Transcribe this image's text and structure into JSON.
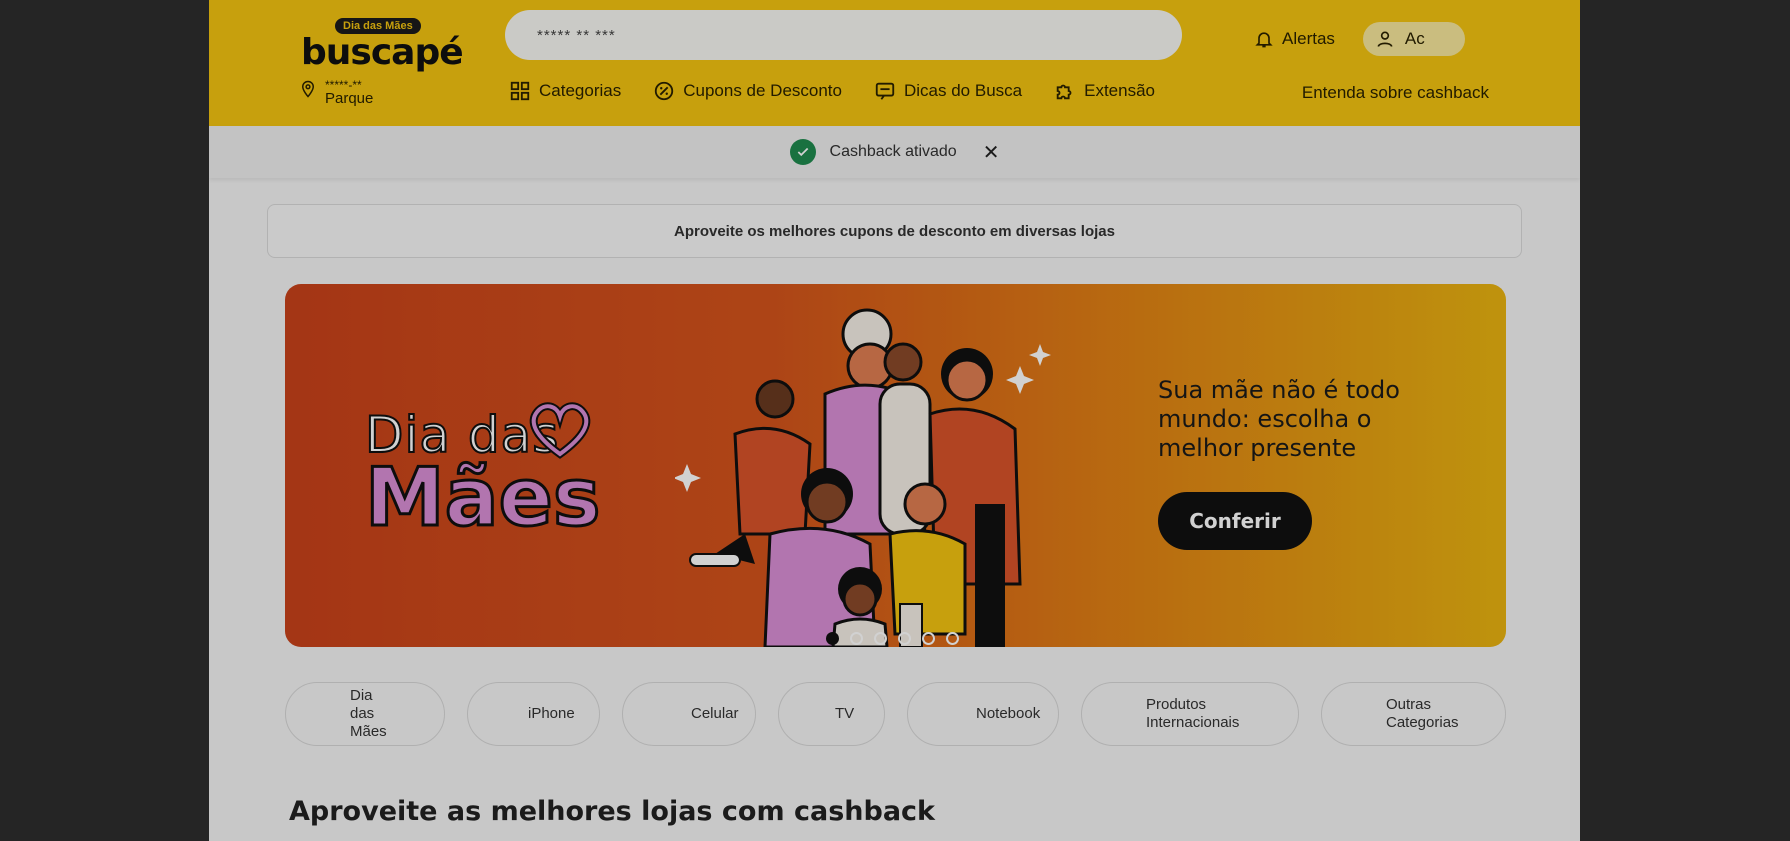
{
  "header": {
    "logo_badge": "Dia das Mães",
    "logo_text": "buscapé",
    "location_line1": "*****-**",
    "location_line2": "Parque",
    "search_value": "***** ** ***",
    "alerts_label": "Alertas",
    "account_label": "Ac",
    "nav": [
      {
        "label": "Categorias",
        "icon": "grid-icon"
      },
      {
        "label": "Cupons de Desconto",
        "icon": "coupon-icon"
      },
      {
        "label": "Dicas do Busca",
        "icon": "chat-icon"
      },
      {
        "label": "Extensão",
        "icon": "puzzle-icon"
      }
    ],
    "cashback_link": "Entenda sobre cashback"
  },
  "cashback_bar": {
    "text": "Cashback ativado",
    "close": "✕"
  },
  "promo_strip": "Aproveite os melhores cupons de desconto em diversas lojas",
  "banner": {
    "title_line1": "Dia das",
    "title_line2": "Mães",
    "copy": "Sua mãe não é todo mundo: escolha o melhor presente",
    "cta": "Conferir",
    "slides": 6,
    "active_slide": 1
  },
  "chips": [
    {
      "label": "Dia das Mães"
    },
    {
      "label": "iPhone"
    },
    {
      "label": "Celular"
    },
    {
      "label": "TV"
    },
    {
      "label": "Notebook"
    },
    {
      "label": "Produtos Internacionais"
    },
    {
      "label": "Outras Categorias"
    }
  ],
  "section_title": "Aproveite as melhores lojas com cashback",
  "colors": {
    "brand_yellow": "#f3c410",
    "banner_orange": "#c9421a",
    "success_green": "#1f8a4f",
    "dark": "#111111"
  }
}
